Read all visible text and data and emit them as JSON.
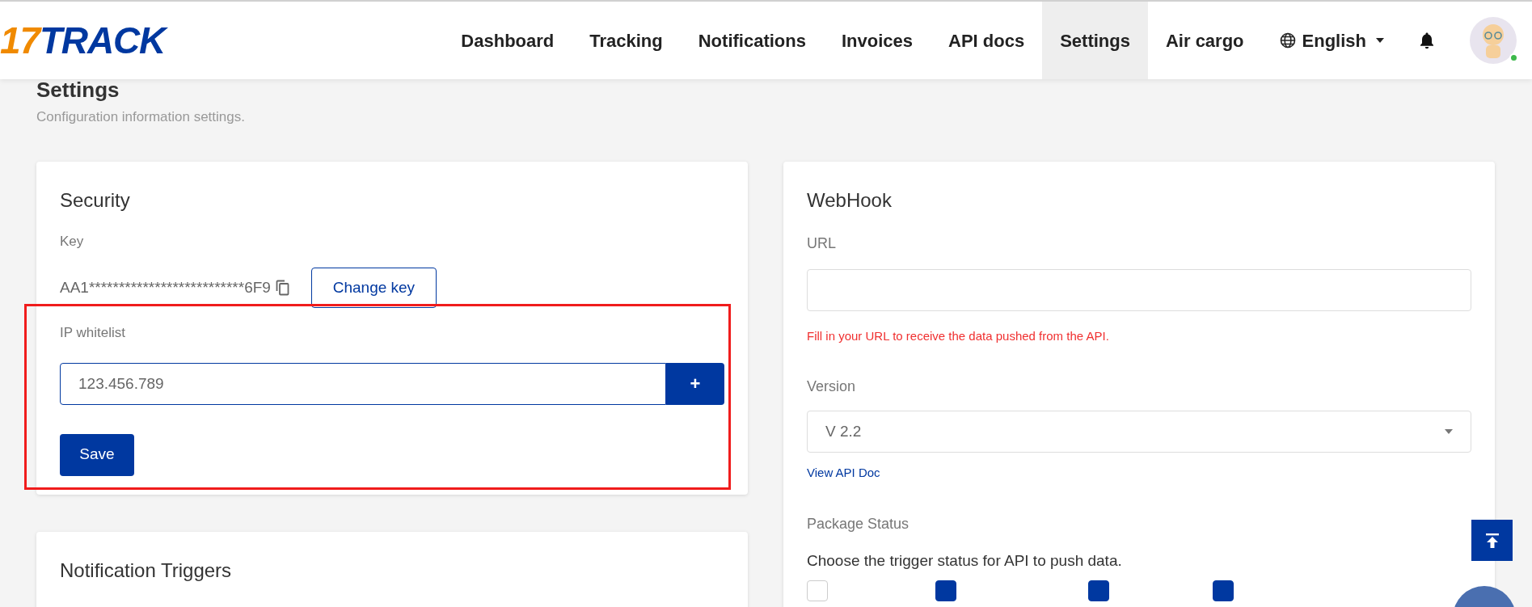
{
  "header": {
    "logo": {
      "digits": "17",
      "word": "TRACK"
    },
    "nav": [
      {
        "label": "Dashboard",
        "selected": false
      },
      {
        "label": "Tracking",
        "selected": false
      },
      {
        "label": "Notifications",
        "selected": false
      },
      {
        "label": "Invoices",
        "selected": false
      },
      {
        "label": "API docs",
        "selected": false
      },
      {
        "label": "Settings",
        "selected": true
      },
      {
        "label": "Air cargo",
        "selected": false
      }
    ],
    "language": "English",
    "user_online": true
  },
  "page": {
    "title": "Settings",
    "subtitle": "Configuration information settings."
  },
  "security": {
    "title": "Security",
    "key_label": "Key",
    "key_value": "AA1**************************6F9",
    "change_key_button": "Change key",
    "ip_whitelist": {
      "label": "IP whitelist",
      "value": "123.456.789",
      "add_button": "+",
      "highlighted": true
    },
    "save_button": "Save"
  },
  "notification_triggers": {
    "title": "Notification Triggers"
  },
  "webhook": {
    "title": "WebHook",
    "url_label": "URL",
    "url_error": "Fill in your URL to receive the data pushed from the API.",
    "version_label": "Version",
    "version_value": "V 2.2",
    "api_doc_link": "View API Doc",
    "package_status_label": "Package Status",
    "package_status_hint": "Choose the trigger status for API to push data.",
    "status_checkboxes": [
      {
        "checked": false
      },
      {
        "checked": true
      },
      {
        "checked": true
      },
      {
        "checked": true
      }
    ]
  }
}
